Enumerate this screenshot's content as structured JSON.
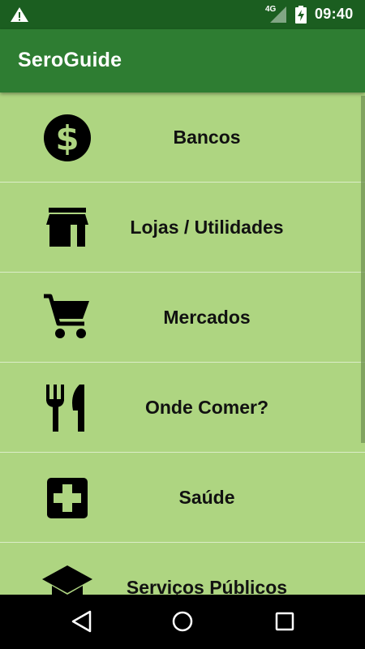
{
  "status_bar": {
    "network": "4G",
    "time": "09:40"
  },
  "app_bar": {
    "title": "SeroGuide"
  },
  "menu": {
    "items": [
      {
        "label": "Bancos",
        "icon": "dollar-coin-icon"
      },
      {
        "label": "Lojas / Utilidades",
        "icon": "store-icon"
      },
      {
        "label": "Mercados",
        "icon": "shopping-cart-icon"
      },
      {
        "label": "Onde Comer?",
        "icon": "fork-knife-icon"
      },
      {
        "label": "Saúde",
        "icon": "medical-cross-icon"
      },
      {
        "label": "Serviços Públicos",
        "icon": "graduation-cap-icon"
      }
    ]
  },
  "colors": {
    "status_bar": "#1b5e20",
    "app_bar": "#2e7d32",
    "list_background": "#aed581",
    "nav_bar": "#000000"
  }
}
